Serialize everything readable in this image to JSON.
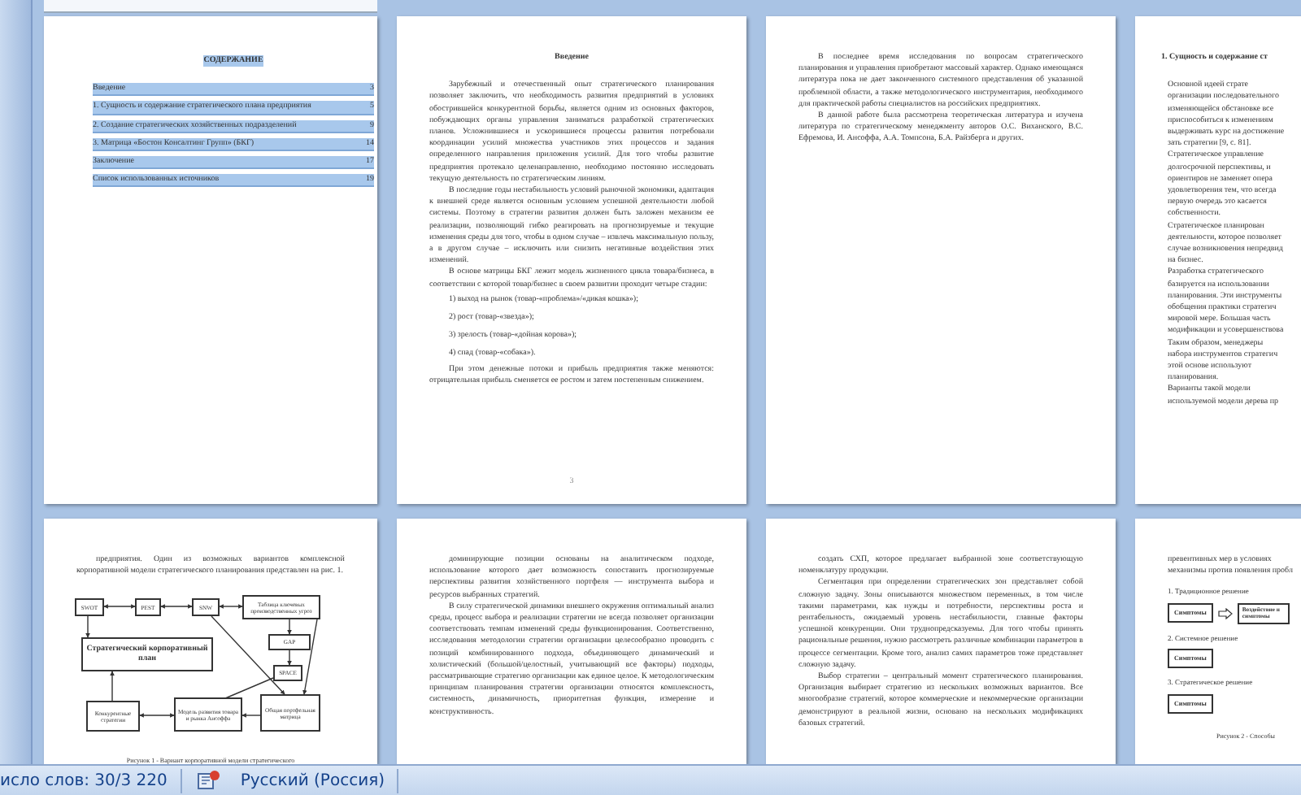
{
  "pages": [
    {
      "kind": "toc",
      "title": "СОДЕРЖАНИЕ",
      "selected": true,
      "entries": [
        {
          "text": "Введение",
          "page": "3"
        },
        {
          "text": "1. Сущность и содержание стратегического плана предприятия",
          "page": "5"
        },
        {
          "text": "2. Создание стратегических хозяйственных подразделений",
          "page": "9"
        },
        {
          "text": "3. Матрица «Бостон Консалтинг Групп» (БКГ)",
          "page": "14"
        },
        {
          "text": "Заключение",
          "page": "17"
        },
        {
          "text": "Список использованных источников",
          "page": "19"
        }
      ]
    },
    {
      "kind": "text",
      "title": "Введение",
      "page_number": "3",
      "blocks": [
        {
          "kind": "para",
          "text": "Зарубежный и отечественный опыт стратегического планирования позволяет заключить, что необходимость развития предприятий в условиях обострившейся конкурентной борьбы, является одним из основных факторов, побуждающих органы управления заниматься разработкой стратегических планов. Усложнившиеся и ускорившиеся процессы развития потребовали координации усилий множества участников этих процессов и задания определенного направления приложения усилий. Для того чтобы развитие предприятия протекало целенаправленно, необходимо постоянно исследовать текущую деятельность по стратегическим линиям."
        },
        {
          "kind": "para",
          "text": "В последние годы нестабильность условий рыночной экономики, адаптация к внешней среде является основным условием успешной деятельности любой системы. Поэтому в стратегии развития должен быть заложен механизм ее реализации, позволяющий гибко реагировать на прогнозируемые и текущие изменения среды для того, чтобы в одном случае – извлечь максимальную пользу, а в другом случае – исключить или снизить негативные воздействия этих изменений."
        },
        {
          "kind": "para",
          "text": "В основе матрицы БКГ лежит модель жизненного цикла товара/бизнеса, в соответствии с которой товар/бизнес в своем развитии проходит четыре стадии:"
        },
        {
          "kind": "item",
          "text": "1) выход на рынок (товар-«проблема»/«дикая кошка»);"
        },
        {
          "kind": "item",
          "text": "2) рост (товар-«звезда»);"
        },
        {
          "kind": "item",
          "text": "3) зрелость (товар-«дойная корова»);"
        },
        {
          "kind": "item",
          "text": "4) спад (товар-«собака»)."
        },
        {
          "kind": "para",
          "text": "При этом денежные потоки и прибыль предприятия также меняются: отрицательная прибыль сменяется ее ростом и затем постепенным снижением."
        }
      ]
    },
    {
      "kind": "text",
      "blocks": [
        {
          "kind": "para",
          "text": "В последнее время исследования по вопросам стратегического планирования и управления приобретают массовый характер. Однако имеющаяся литература пока не дает законченного системного представления об указанной проблемной области, а также методологического инструментария, необходимого для практической работы специалистов на российских предприятиях."
        },
        {
          "kind": "para",
          "text": "В данной работе была рассмотрена теоретическая литература и изучена литература по стратегическому менеджменту авторов О.С. Виханского, В.С. Ефремова, И. Ансоффа, А.А. Томпсона, Б.А. Райзберга и других."
        }
      ]
    },
    {
      "kind": "edge",
      "title": "1. Сущность и содержание ст",
      "blocks": [
        {
          "kind": "line",
          "text": "Основной идеей страте"
        },
        {
          "kind": "line",
          "text": "организации последовательного"
        },
        {
          "kind": "line",
          "text": "изменяющейся обстановке все"
        },
        {
          "kind": "line",
          "text": "приспособиться к изменениям"
        },
        {
          "kind": "line",
          "text": "выдерживать курс на достижение"
        },
        {
          "kind": "line",
          "text": "зать стратегии [9, с. 81]."
        },
        {
          "kind": "line",
          "text": "Стратегическое управление"
        },
        {
          "kind": "line",
          "text": "долгосрочной перспективы, и"
        },
        {
          "kind": "line",
          "text": "ориентиров не заменяет опера"
        },
        {
          "kind": "line",
          "text": "удовлетворения тем, что всегда"
        },
        {
          "kind": "line",
          "text": "первую очередь это касается"
        },
        {
          "kind": "line",
          "text": "собственности."
        },
        {
          "kind": "line",
          "text": "Стратегическое планирован"
        },
        {
          "kind": "line",
          "text": "деятельности, которое позволяет"
        },
        {
          "kind": "line",
          "text": "случае возникновения непредвид"
        },
        {
          "kind": "line",
          "text": "на бизнес."
        },
        {
          "kind": "line",
          "text": "Разработка стратегического"
        },
        {
          "kind": "line",
          "text": "базируется на использовании"
        },
        {
          "kind": "line",
          "text": "планирования. Эти инструменты"
        },
        {
          "kind": "line",
          "text": "обобщения практики стратегич"
        },
        {
          "kind": "line",
          "text": "мировой мере. Большая часть"
        },
        {
          "kind": "line",
          "text": "модификации и усовершенствова"
        },
        {
          "kind": "line",
          "text": "Таким образом, менеджеры"
        },
        {
          "kind": "line",
          "text": "набора инструментов стратегич"
        },
        {
          "kind": "line",
          "text": "этой основе используют"
        },
        {
          "kind": "line",
          "text": "планирования."
        },
        {
          "kind": "line",
          "text": "Варианты такой модели"
        },
        {
          "kind": "line",
          "text": "используемой модели дерева пр"
        }
      ]
    },
    {
      "kind": "figure",
      "blocks": [
        {
          "kind": "para",
          "text": "предприятия. Один из возможных вариантов комплексной корпоративной модели стратегического планирования представлен на рис. 1."
        }
      ],
      "figure": {
        "kind": "network",
        "boxes": [
          {
            "text": "SWOT"
          },
          {
            "text": "PEST"
          },
          {
            "text": "SNW"
          },
          {
            "text": "Таблица ключевых производственных угроз"
          },
          {
            "text": "Стратегический корпоративный план"
          },
          {
            "text": "GAP"
          },
          {
            "text": "SPACE"
          },
          {
            "text": "Конкурентные стратегии"
          },
          {
            "text": "Модель развития товара и рынка Ансоффа"
          },
          {
            "text": "Общая портфельная матрица"
          }
        ],
        "caption": "Рисунок 1 - Вариант корпоративной модели стратегического"
      }
    },
    {
      "kind": "text",
      "blocks": [
        {
          "kind": "para",
          "text": "доминирующие позиции основаны на аналитическом подходе, использование которого дает возможность сопоставить прогнозируемые перспективы развития хозяйственного портфеля — инструмента выбора и ресурсов выбранных стратегий."
        },
        {
          "kind": "para",
          "text": "В силу стратегической динамики внешнего окружения оптимальный анализ среды, процесс выбора и реализации стратегии не всегда позволяет организации соответствовать темпам изменений среды функционирования. Соответственно, исследования методологии стратегии организации целесообразно проводить с позиций комбинированного подхода, объединяющего динамический и холистический (большой/целостный, учитывающий все факторы) подходы, рассматривающие стратегию организации как единое целое. К методологическим принципам планирования стратегии организации относятся комплексность, системность, динамичность, приоритетная функция, измерение и конструктивность."
        }
      ]
    },
    {
      "kind": "text",
      "blocks": [
        {
          "kind": "para",
          "text": "создать СХП, которое предлагает выбранной зоне соответствующую номенклатуру продукции."
        },
        {
          "kind": "para",
          "text": "Сегментация при определении стратегических зон представляет собой сложную задачу. Зоны описываются множеством переменных, в том числе такими параметрами, как нужды и потребности, перспективы роста и рентабельность, ожидаемый уровень нестабильности, главные факторы успешной конкуренции. Они труднопредсказуемы. Для того чтобы принять рациональные решения, нужно рассмотреть различные комбинации параметров в процессе сегментации. Кроме того, анализ самих параметров тоже представляет сложную задачу."
        },
        {
          "kind": "para",
          "text": "Выбор стратегии – центральный момент стратегического планирования. Организация выбирает стратегию из нескольких возможных вариантов. Все многообразие стратегий, которое коммерческие и некоммерческие организации демонстрируют в реальной жизни, основано на нескольких модификациях базовых стратегий."
        }
      ]
    },
    {
      "kind": "figure",
      "blocks": [
        {
          "kind": "line",
          "text": "превентивных мер в условиях"
        },
        {
          "kind": "line",
          "text": "механизмы против появления пробл"
        }
      ],
      "figure": {
        "kind": "flow",
        "rows": [
          {
            "label": "1. Традиционное решение",
            "boxes": [
              {
                "text": "Симптомы"
              },
              {
                "text": "Воздействие н симптомы"
              }
            ]
          },
          {
            "label": "2. Системное решение",
            "boxes": [
              {
                "text": "Симптомы"
              }
            ]
          },
          {
            "label": "3. Стратегическое решение",
            "boxes": [
              {
                "text": "Симптомы"
              }
            ]
          }
        ],
        "caption": "Рисунок 2 - Способы"
      }
    }
  ],
  "status_bar": {
    "word_count": "исло слов: 30/3 220",
    "language": "Русский (Россия)"
  }
}
